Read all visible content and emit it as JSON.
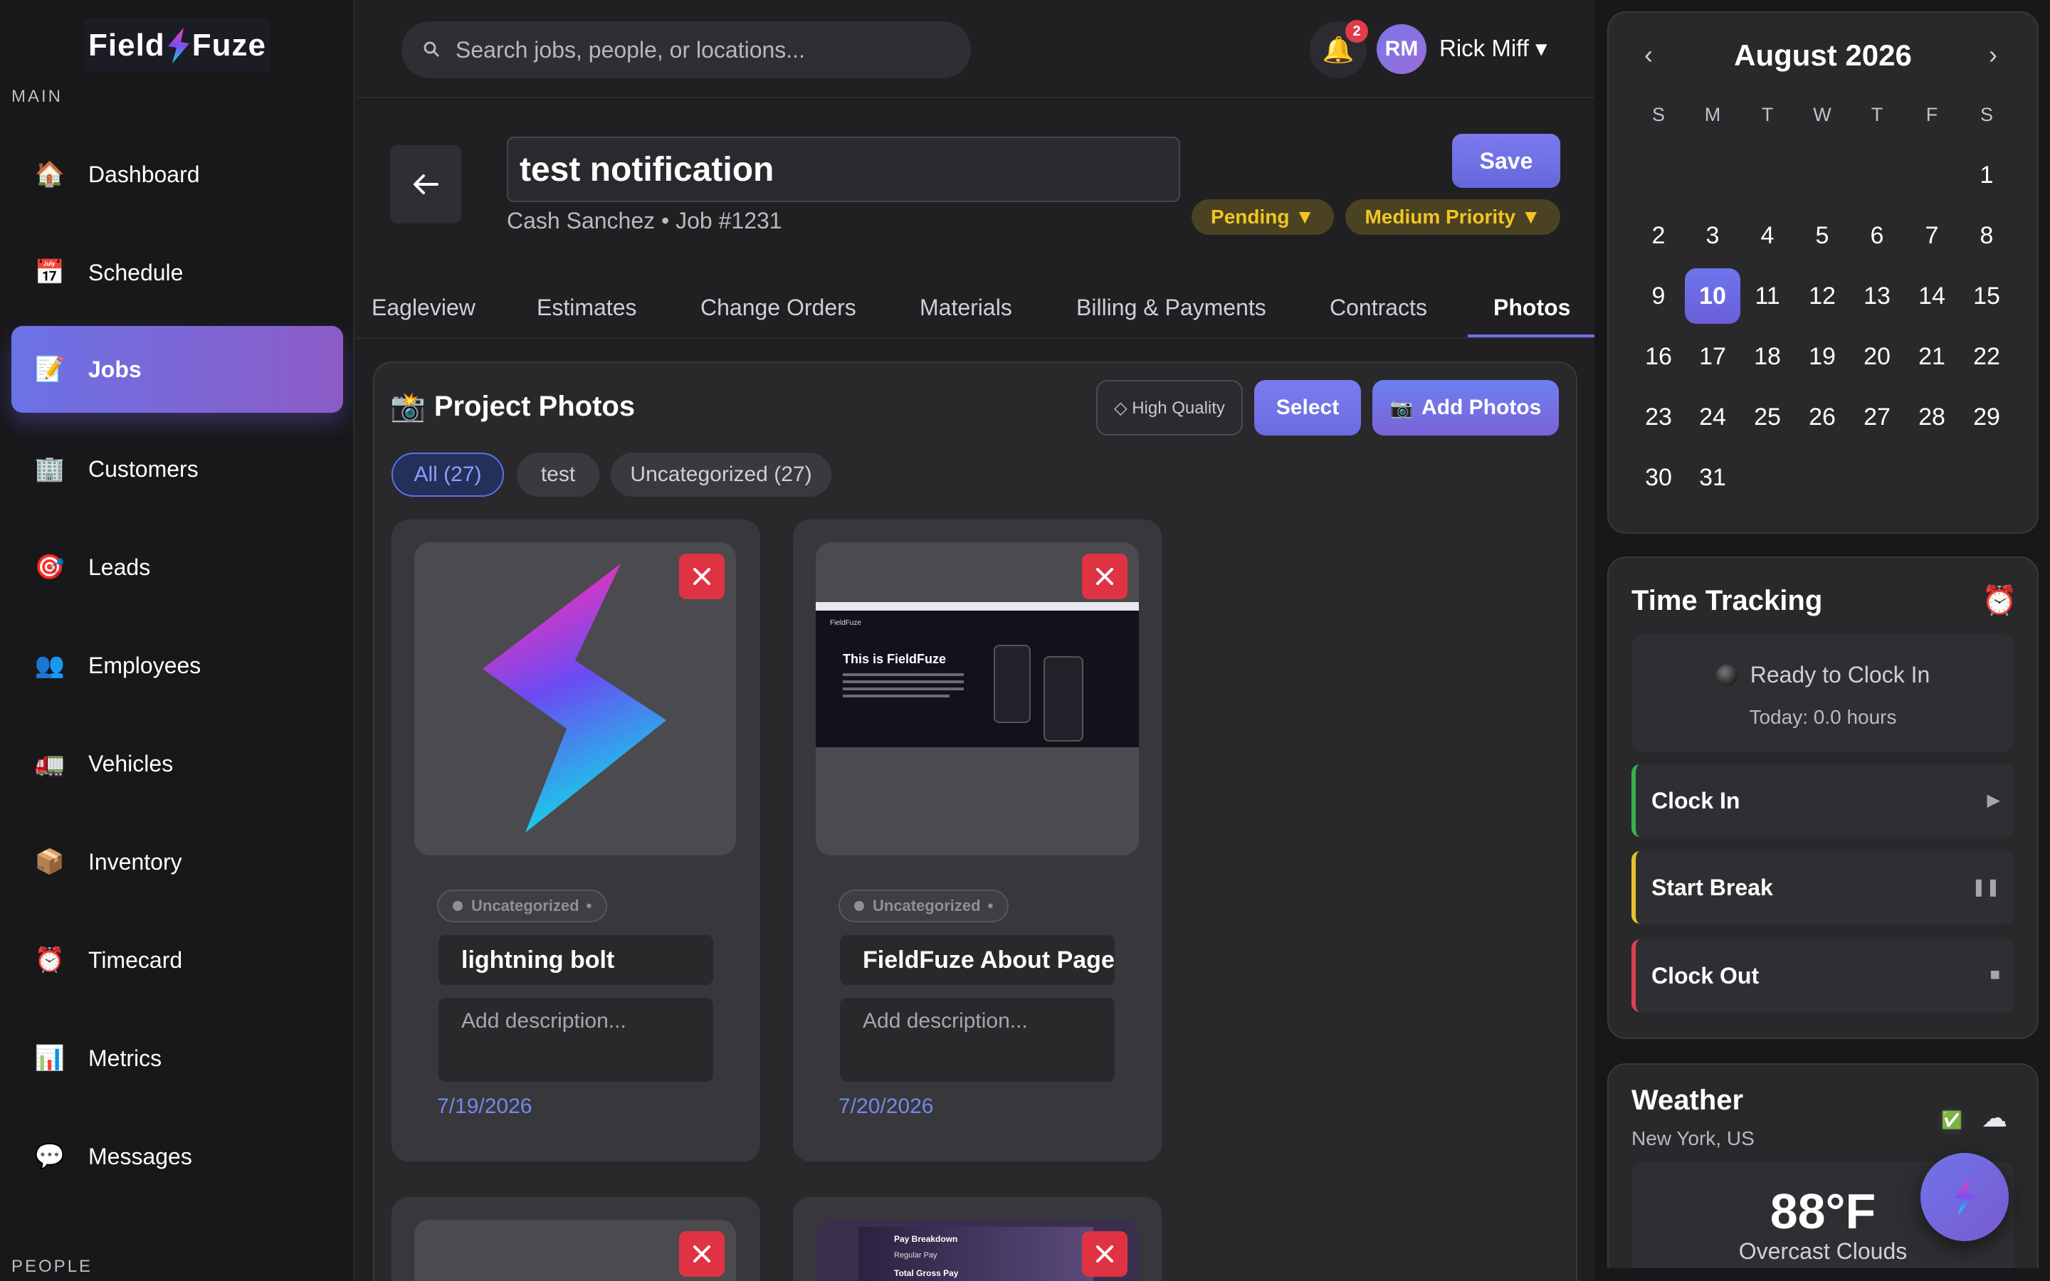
{
  "app": {
    "logo_left": "Field",
    "logo_right": "Fuze"
  },
  "sidebar": {
    "section_main": "MAIN",
    "section_people": "PEOPLE",
    "items": [
      {
        "label": "Dashboard",
        "icon": "house-icon"
      },
      {
        "label": "Schedule",
        "icon": "calendar-icon"
      },
      {
        "label": "Jobs",
        "icon": "memo-icon"
      },
      {
        "label": "Customers",
        "icon": "office-building-icon"
      },
      {
        "label": "Leads",
        "icon": "target-icon"
      },
      {
        "label": "Employees",
        "icon": "people-icon"
      },
      {
        "label": "Vehicles",
        "icon": "truck-icon"
      },
      {
        "label": "Inventory",
        "icon": "package-icon"
      },
      {
        "label": "Timecard",
        "icon": "alarm-clock-icon"
      },
      {
        "label": "Metrics",
        "icon": "bar-chart-icon"
      },
      {
        "label": "Messages",
        "icon": "speech-bubble-icon"
      }
    ],
    "active": "Jobs"
  },
  "topbar": {
    "search_placeholder": "Search jobs, people, or locations...",
    "notification_count": "2",
    "user_initials": "RM",
    "user_name": "Rick Miff ▾"
  },
  "job": {
    "title": "test notification",
    "subline": "Cash Sanchez • Job #1231",
    "save_label": "Save",
    "status": "Pending ▼",
    "priority": "Medium Priority ▼"
  },
  "tabs": [
    "Eagleview",
    "Estimates",
    "Change Orders",
    "Materials",
    "Billing & Payments",
    "Contracts",
    "Photos"
  ],
  "active_tab": "Photos",
  "photos": {
    "title": "Project Photos",
    "high_quality_label": "◇ High Quality",
    "select_label": "Select",
    "add_label": "Add Photos",
    "filters": [
      "All (27)",
      "test",
      "Uncategorized (27)"
    ],
    "cards": [
      {
        "category": "Uncategorized",
        "name": "lightning bolt",
        "description_placeholder": "Add description...",
        "date": "7/19/2026"
      },
      {
        "category": "Uncategorized",
        "name": "FieldFuze About Page",
        "description_placeholder": "Add description...",
        "date": "7/20/2026"
      }
    ],
    "about_page_preview": {
      "brand": "FieldFuze",
      "heading": "This is FieldFuze"
    },
    "pay_preview": {
      "line1": "Pay Breakdown",
      "line2": "Regular Pay",
      "line3": "Total Gross Pay"
    }
  },
  "calendar": {
    "month": "August 2026",
    "prev": "‹",
    "next": "›",
    "weekdays": [
      "S",
      "M",
      "T",
      "W",
      "T",
      "F",
      "S"
    ],
    "first_weekday": 6,
    "days_in_month": 31,
    "today": 10
  },
  "time_tracking": {
    "title": "Time Tracking",
    "status": "Ready to Clock In",
    "today": "Today: 0.0 hours",
    "actions": [
      {
        "label": "Clock In",
        "accent": "#3fae4f",
        "icon": "▶"
      },
      {
        "label": "Start Break",
        "accent": "#e7c22b",
        "icon": "❚❚"
      },
      {
        "label": "Clock Out",
        "accent": "#d8424e",
        "icon": "■"
      }
    ]
  },
  "weather": {
    "title": "Weather",
    "location": "New York, US",
    "temp": "88°F",
    "condition": "Overcast Clouds"
  },
  "colors": {
    "accent": "#6c72e6",
    "danger": "#df3343",
    "warning": "#f2c522"
  }
}
